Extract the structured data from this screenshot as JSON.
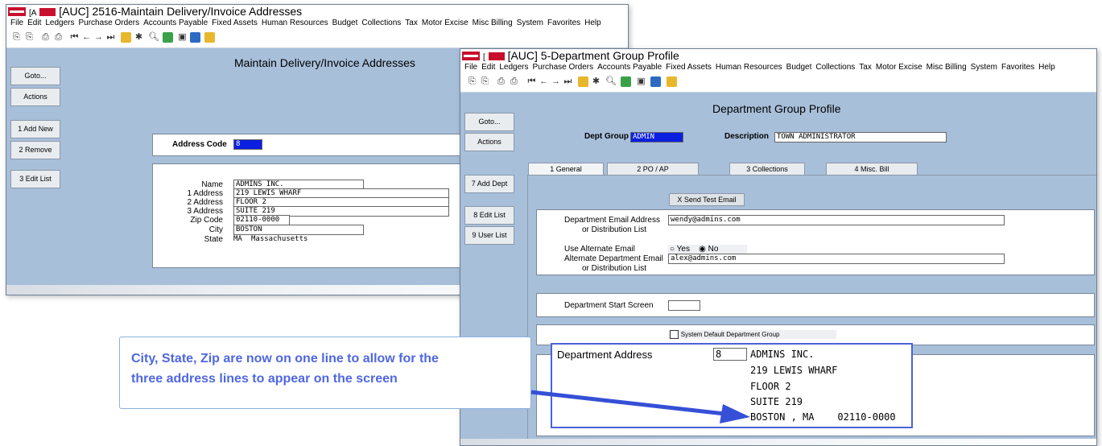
{
  "win1": {
    "title": "[AUC] 2516-Maintain Delivery/Invoice Addresses",
    "title_prefix": "[A",
    "menu": [
      "File",
      "Edit",
      "Ledgers",
      "Purchase Orders",
      "Accounts Payable",
      "Fixed Assets",
      "Human Resources",
      "Budget",
      "Collections",
      "Tax",
      "Motor Excise",
      "Misc Billing",
      "System",
      "Favorites",
      "Help"
    ],
    "sidebar": [
      "Goto...",
      "Actions",
      "1 Add New",
      "2 Remove",
      "3 Edit List"
    ],
    "page_title": "Maintain Delivery/Invoice Addresses",
    "address_code_label": "Address Code",
    "address_code_value": "8",
    "fields": {
      "name_label": "Name",
      "name_value": "ADMINS INC.",
      "address1_label": "1 Address",
      "address1_value": "219 LEWIS WHARF",
      "address2_label": "2 Address",
      "address2_value": "FLOOR 2",
      "address3_label": "3 Address",
      "address3_value": "SUITE 219",
      "zip_label": "Zip Code",
      "zip_value": "02110-0000",
      "city_label": "City",
      "city_value": "BOSTON",
      "state_label": "State",
      "state_code": "MA",
      "state_name": "Massachusetts"
    }
  },
  "win2": {
    "title": "[AUC] 5-Department Group Profile",
    "title_prefix": "[",
    "menu": [
      "File",
      "Edit",
      "Ledgers",
      "Purchase Orders",
      "Accounts Payable",
      "Fixed Assets",
      "Human Resources",
      "Budget",
      "Collections",
      "Tax",
      "Motor Excise",
      "Misc Billing",
      "System",
      "Favorites",
      "Help"
    ],
    "sidebar": [
      "Goto...",
      "Actions",
      "7 Add Dept",
      "8 Edit List",
      "9 User List"
    ],
    "page_title": "Department Group Profile",
    "dept_group_label": "Dept Group",
    "dept_group_value": "ADMIN",
    "description_label": "Description",
    "description_value": "TOWN ADMINISTRATOR",
    "tabs": [
      "1 General",
      "2 PO / AP",
      "3 Collections",
      "4 Misc. Bill"
    ],
    "send_test_email": "X Send Test Email",
    "email_label_1": "Department Email Address",
    "email_label_2": "or Distribution List",
    "email_value": "wendy@admins.com",
    "use_alt_label": "Use Alternate Email",
    "yes_label": "Yes",
    "no_label": "No",
    "alt_label_1": "Alternate Department Email",
    "alt_label_2": "or Distribution List",
    "alt_value": "alex@admins.com",
    "start_screen_label": "Department Start Screen",
    "system_default_label": "System Default Department Group",
    "dept_address_label": "Department Address",
    "dept_address_code": "8",
    "address_lines": [
      "ADMINS INC.",
      "219 LEWIS WHARF",
      "FLOOR 2",
      "SUITE 219",
      "BOSTON , MA    02110-0000"
    ]
  },
  "callout": {
    "line1": "City, State, Zip are now on one line to allow for the",
    "line2": "three address lines to appear on the screen"
  },
  "colors": {
    "accent": "#4a63d8",
    "callout_text": "#4f67e0",
    "window_bg": "#a8bfda",
    "selection": "#0a1fe0"
  }
}
